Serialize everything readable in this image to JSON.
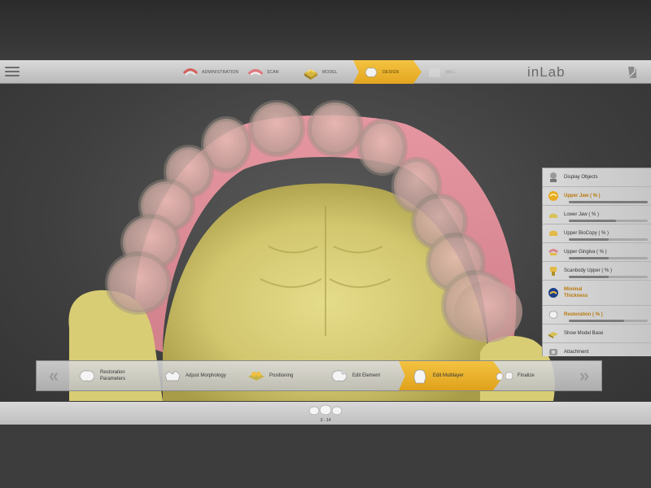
{
  "header": {
    "menu_icon": "hamburger-menu-icon",
    "brand": "inLab",
    "brand_icon": "flip-page-icon",
    "steps": [
      {
        "label": "ADMINISTRATION",
        "icon": "administration-icon",
        "state": "normal"
      },
      {
        "label": "SCAN",
        "icon": "scan-icon",
        "state": "normal"
      },
      {
        "label": "MODEL",
        "icon": "model-icon",
        "state": "normal"
      },
      {
        "label": "DESIGN",
        "icon": "design-icon",
        "state": "active"
      },
      {
        "label": "MILL",
        "icon": "mill-icon",
        "state": "disabled"
      }
    ]
  },
  "display_panel": {
    "title": "Display Objects",
    "title_icon": "display-objects-icon",
    "items": [
      {
        "label": "Upper Jaw  ( % )",
        "icon": "upper-jaw-icon",
        "highlight": true,
        "level": 1.0
      },
      {
        "label": "Lower Jaw  ( % )",
        "icon": "lower-jaw-icon",
        "highlight": false,
        "level": 0.6
      },
      {
        "label": "Upper BioCopy  ( % )",
        "icon": "upper-biocopy-icon",
        "highlight": false,
        "level": 0.5
      },
      {
        "label": "Upper Gingiva  ( % )",
        "icon": "upper-gingiva-icon",
        "highlight": false,
        "level": 0.5
      },
      {
        "label": "Scanbody Upper  ( % )",
        "icon": "scanbody-upper-icon",
        "highlight": false,
        "level": 0.5
      },
      {
        "label": "Minimal Thickness",
        "icon": "minimal-thickness-icon",
        "highlight": true,
        "level": null
      },
      {
        "label": "Restoration  ( % )",
        "icon": "restoration-icon",
        "highlight": true,
        "level": 0.7
      },
      {
        "label": "Show Model Base",
        "icon": "model-base-icon",
        "highlight": false,
        "level": null
      },
      {
        "label": "Attachment",
        "icon": "attachment-icon",
        "highlight": false,
        "level": null
      }
    ]
  },
  "workflow": {
    "prev_icon": "double-chevron-left-icon",
    "next_icon": "double-chevron-right-icon",
    "steps": [
      {
        "label": "Restoration Parameters",
        "icon": "restoration-parameters-icon",
        "active": false
      },
      {
        "label": "Adjust Morphology",
        "icon": "adjust-morphology-icon",
        "active": false
      },
      {
        "label": "Positioning",
        "icon": "positioning-icon",
        "active": false
      },
      {
        "label": "Edit Element",
        "icon": "edit-element-icon",
        "active": false
      },
      {
        "label": "Edit Multilayer",
        "icon": "edit-multilayer-icon",
        "active": true
      },
      {
        "label": "Finalize",
        "icon": "finalize-icon",
        "active": false
      }
    ]
  },
  "tooth_selector": {
    "icon": "tooth-selection-icon",
    "range": "3 - 14"
  },
  "colors": {
    "accent": "#e8ac22",
    "model": "#d8ce7a",
    "gingiva": "#e6a2ad",
    "tooth": "#d9b0ad"
  }
}
